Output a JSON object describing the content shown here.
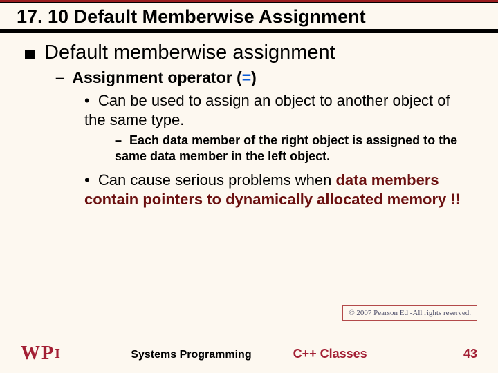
{
  "title": "17. 10 Default Memberwise Assignment",
  "bullets": {
    "lvl1": "Default memberwise assignment",
    "lvl2_pre": "Assignment operator (",
    "lvl2_eq": "=",
    "lvl2_post": ")",
    "lvl3a": "Can be used to assign an object to another object of the same type.",
    "lvl4a": "Each data member of the right object is assigned to the same data member in the left object.",
    "lvl3b_pre": "Can cause serious problems when ",
    "lvl3b_em": "data members contain pointers to dynamically allocated memory !!"
  },
  "copyright": "© 2007 Pearson Ed -All rights reserved.",
  "footer": {
    "course": "Systems Programming",
    "topic": "C++ Classes",
    "page": "43"
  }
}
